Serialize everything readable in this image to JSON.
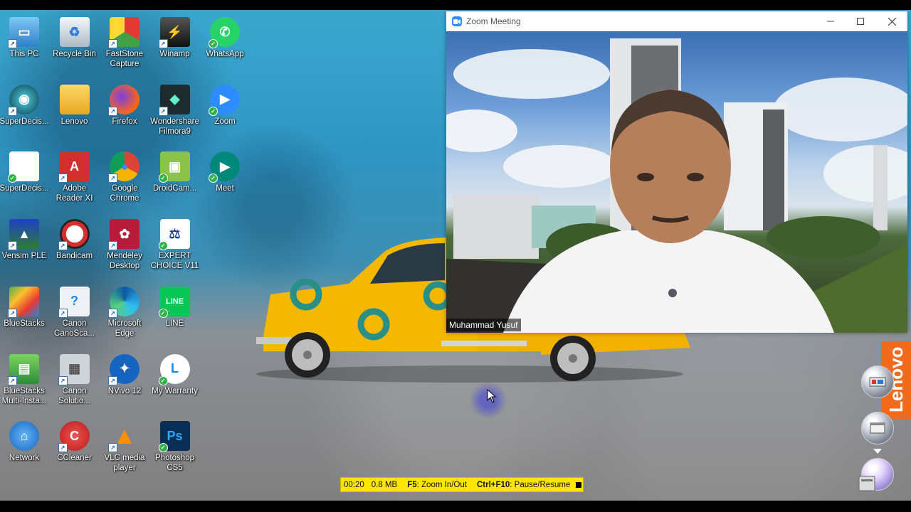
{
  "desktop": {
    "icons": [
      {
        "label": "This PC",
        "icon": "computer-icon"
      },
      {
        "label": "Recycle Bin",
        "icon": "recycle-bin-icon"
      },
      {
        "label": "FastStone Capture",
        "icon": "faststone-icon"
      },
      {
        "label": "Winamp",
        "icon": "winamp-icon"
      },
      {
        "label": "WhatsApp",
        "icon": "whatsapp-icon"
      },
      {
        "label": "SuperDecis...",
        "icon": "superdecisions-icon"
      },
      {
        "label": "Lenovo",
        "icon": "folder-icon"
      },
      {
        "label": "Firefox",
        "icon": "firefox-icon"
      },
      {
        "label": "Wondershare Filmora9",
        "icon": "filmora-icon"
      },
      {
        "label": "Zoom",
        "icon": "zoom-icon"
      },
      {
        "label": "SuperDecis...",
        "icon": "document-icon"
      },
      {
        "label": "Adobe Reader XI",
        "icon": "adobe-reader-icon"
      },
      {
        "label": "Google Chrome",
        "icon": "chrome-icon"
      },
      {
        "label": "DroidCam...",
        "icon": "droidcam-icon"
      },
      {
        "label": "Meet",
        "icon": "meet-icon"
      },
      {
        "label": "Vensim PLE",
        "icon": "vensim-icon"
      },
      {
        "label": "Bandicam",
        "icon": "bandicam-icon"
      },
      {
        "label": "Mendeley Desktop",
        "icon": "mendeley-icon"
      },
      {
        "label": "EXPERT CHOICE V11",
        "icon": "expert-choice-icon"
      },
      {
        "label": "BlueStacks",
        "icon": "bluestacks-icon"
      },
      {
        "label": "Canon CanoSca...",
        "icon": "canon-scan-icon"
      },
      {
        "label": "Microsoft Edge",
        "icon": "edge-icon"
      },
      {
        "label": "LINE",
        "icon": "line-icon"
      },
      {
        "label": "BlueStacks Multi-Insta...",
        "icon": "bluestacks-multi-icon"
      },
      {
        "label": "Canon Solutio...",
        "icon": "canon-solution-icon"
      },
      {
        "label": "NVivo 12",
        "icon": "nvivo-icon"
      },
      {
        "label": "My Warranty",
        "icon": "warranty-icon"
      },
      {
        "label": "Network",
        "icon": "network-icon"
      },
      {
        "label": "CCleaner",
        "icon": "ccleaner-icon"
      },
      {
        "label": "VLC media player",
        "icon": "vlc-icon"
      },
      {
        "label": "Photoshop CS5",
        "icon": "photoshop-icon"
      }
    ]
  },
  "zoom": {
    "title": "Zoom Meeting",
    "participant_name": "Muhammad Yusuf",
    "icon": "zoom-icon"
  },
  "recorder": {
    "time": "00:20",
    "size": "0.8 MB",
    "hotkey1_key": "F5",
    "hotkey1_action": ": Zoom In/Out",
    "hotkey2_key": "Ctrl+F10",
    "hotkey2_action": ": Pause/Resume"
  },
  "lenovo": {
    "brand": "Lenovo"
  },
  "colors": {
    "zoom_blue": "#2d8cff",
    "recorder_yellow": "#ffe600",
    "lenovo_orange": "#f26a1b"
  }
}
